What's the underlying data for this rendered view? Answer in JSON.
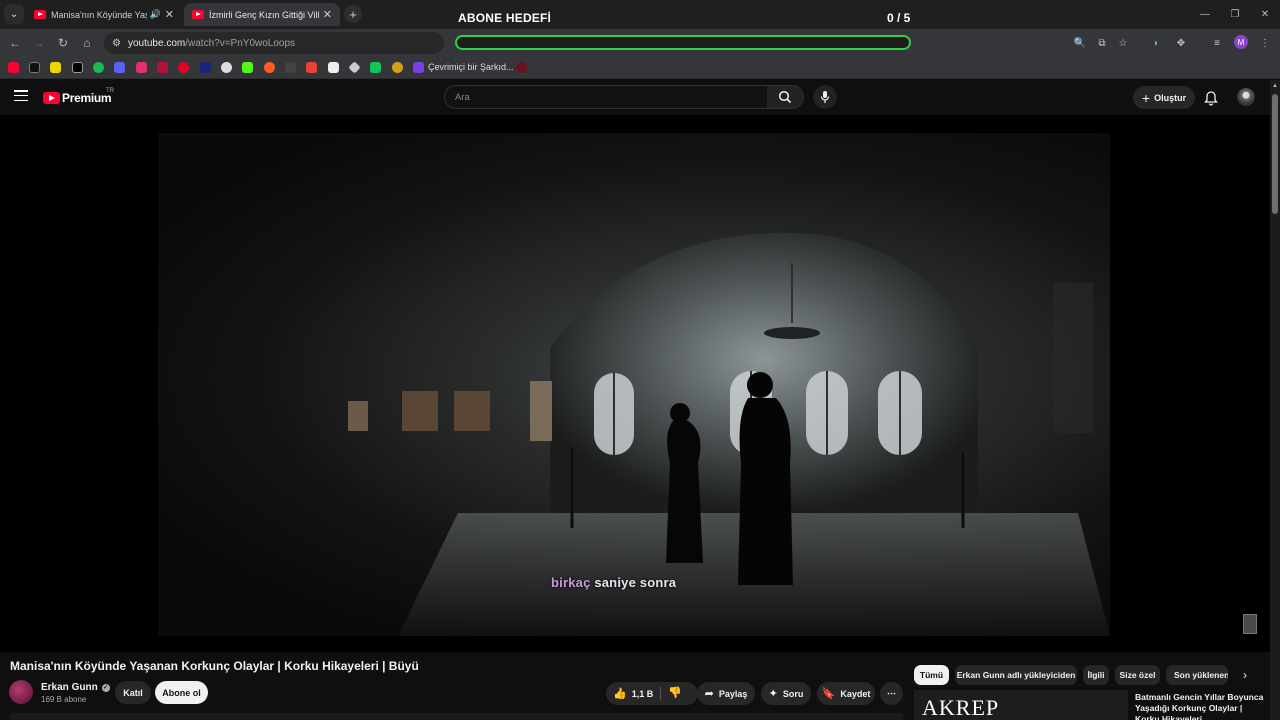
{
  "browser": {
    "tabs": [
      {
        "title": "Manisa'nın Köyünde Yaşanan Korkunç Olaylar",
        "active": false,
        "audio": true
      },
      {
        "title": "İzmirli Genç Kızın Gittiği Villada",
        "active": true,
        "audio": false
      }
    ],
    "overlay": {
      "goal_title": "ABONE HEDEFİ",
      "goal_count": "0 / 5"
    },
    "address": {
      "host": "youtube.com",
      "path": "/watch?v=PnY0woLoops"
    },
    "bookmark_label": "Çevrimiçi bir Şarkıd..."
  },
  "youtube": {
    "logo_text": "Premium",
    "country_code": "TR",
    "search_placeholder": "Ara",
    "create_label": "Oluştur"
  },
  "video": {
    "subtitle_highlight": "birkaç",
    "subtitle_rest": " saniye sonra",
    "title": "Manisa'nın Köyünde Yaşanan Korkunç Olaylar | Korku Hikayeleri | Büyü"
  },
  "channel": {
    "name": "Erkan Gunn",
    "subscribers": "169 B abone",
    "join_label": "Katıl",
    "subscribe_label": "Abone ol"
  },
  "actions": {
    "likes": "1,1 B",
    "share": "Paylaş",
    "ask": "Soru",
    "save": "Kaydet"
  },
  "chips": [
    "Tümü",
    "Erkan Gunn adlı yükleyiciden",
    "İlgili",
    "Size özel",
    "Son yüklenenler"
  ],
  "recommendation": {
    "thumb_text": "AKREP",
    "title": "Batmanlı Gencin Yıllar Boyunca Yaşadığı Korkunç Olaylar | Korku Hikayeleri"
  },
  "colors": {
    "goal_border": "#2fd14a",
    "brand_red": "#ff0033",
    "subtitle_highlight": "#c79bd8"
  }
}
